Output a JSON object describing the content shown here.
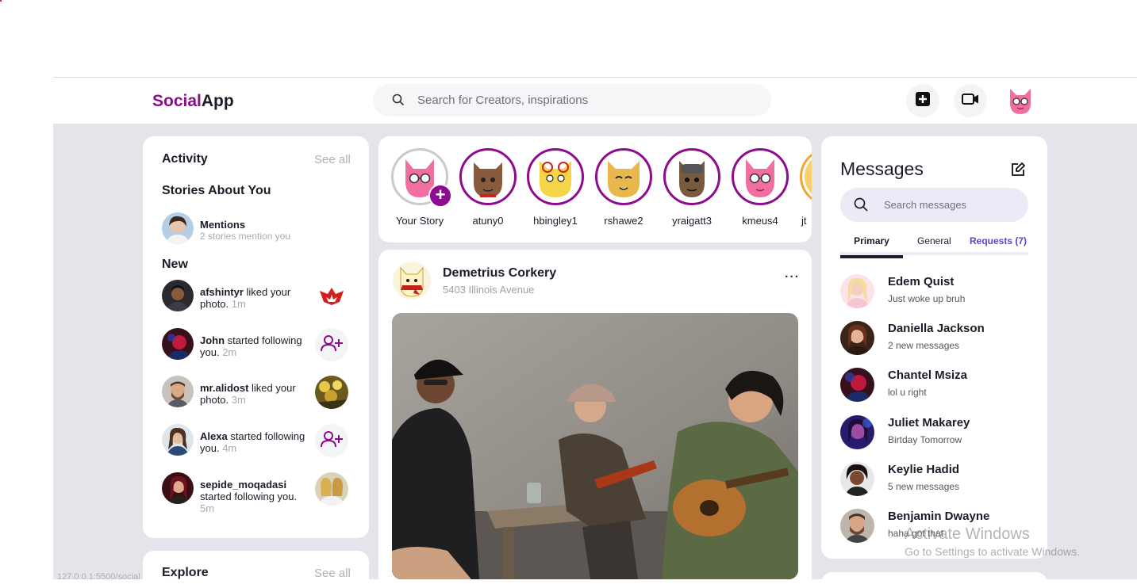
{
  "app": {
    "logo_accent": "Social",
    "logo_rest": "App"
  },
  "search": {
    "placeholder": "Search for Creators, inspirations"
  },
  "activity": {
    "title": "Activity",
    "see_all": "See all",
    "stories_title": "Stories About You",
    "mentions": {
      "label": "Mentions",
      "sub": "2 stories mention you"
    },
    "new_title": "New",
    "items": [
      {
        "user": "afshintyr",
        "action": " liked your photo.",
        "time": "1m"
      },
      {
        "user": "John",
        "action": " started following you.",
        "time": "2m"
      },
      {
        "user": "mr.alidost",
        "action": " liked your photo.",
        "time": "3m"
      },
      {
        "user": "Alexa",
        "action": " started following you.",
        "time": "4m"
      },
      {
        "user": "sepide_moqadasi",
        "action": " started following you.",
        "time": "5m"
      }
    ]
  },
  "explore": {
    "title": "Explore",
    "see_all": "See all"
  },
  "stories": [
    {
      "name": "Your Story"
    },
    {
      "name": "atuny0"
    },
    {
      "name": "hbingley1"
    },
    {
      "name": "rshawe2"
    },
    {
      "name": "yraigatt3"
    },
    {
      "name": "kmeus4"
    },
    {
      "name": "jt"
    }
  ],
  "post": {
    "author": "Demetrius Corkery",
    "location": "5403 Illinois Avenue",
    "more": "···"
  },
  "messages": {
    "title": "Messages",
    "search_placeholder": "Search messages",
    "tabs": {
      "primary": "Primary",
      "general": "General",
      "requests": "Requests (7)"
    },
    "items": [
      {
        "name": "Edem Quist",
        "text": "Just woke up bruh"
      },
      {
        "name": "Daniella Jackson",
        "text": "2 new messages"
      },
      {
        "name": "Chantel Msiza",
        "text": "lol u right"
      },
      {
        "name": "Juliet Makarey",
        "text": "Birtday Tomorrow"
      },
      {
        "name": "Keylie Hadid",
        "text": "5 new messages"
      },
      {
        "name": "Benjamin Dwayne",
        "text": "haha got that"
      }
    ]
  },
  "overlay": {
    "watermark_title": "Activate Windows",
    "watermark_sub": "Go to Settings to activate Windows.",
    "status_url": "127.0.0.1:5500/social"
  },
  "colors": {
    "accent": "#8e0a8e",
    "requests": "#5b45c9",
    "background": "#e3e5ea"
  }
}
